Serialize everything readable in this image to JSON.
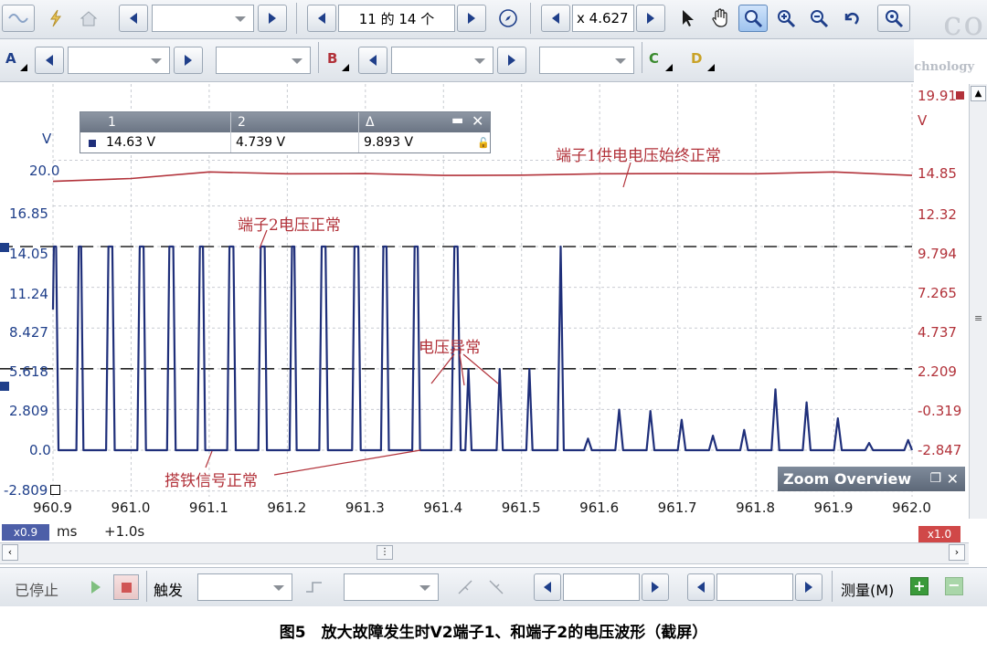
{
  "toolbar": {
    "buffer_nav": "11 的 14 个",
    "zoom_value": "x 4.627"
  },
  "channels": {
    "a": "A",
    "b": "B",
    "c": "C",
    "d": "D"
  },
  "logo": {
    "text": "co",
    "sub": "Technology"
  },
  "ruler_table": {
    "headers": [
      "1",
      "2",
      "Δ"
    ],
    "values": [
      "14.63 V",
      "4.739 V",
      "9.893 V"
    ]
  },
  "axes": {
    "left_unit": "V",
    "right_unit": "V",
    "left_ticks": [
      "20.0",
      "16.85",
      "14.05",
      "11.24",
      "8.427",
      "5.618",
      "2.809",
      "0.0",
      "-2.809"
    ],
    "right_ticks": [
      "19.91",
      "14.85",
      "12.32",
      "9.794",
      "7.265",
      "4.737",
      "2.209",
      "-0.319",
      "-2.847"
    ],
    "x_ticks": [
      "960.9",
      "961.0",
      "961.1",
      "961.2",
      "961.3",
      "961.4",
      "961.5",
      "961.6",
      "961.7",
      "961.8",
      "961.9",
      "962.0"
    ],
    "x_unit": "ms",
    "x_offset": "+1.0s",
    "left_zoom": "x0.9",
    "right_zoom": "x1.0"
  },
  "annotations": {
    "red_line": "端子1供电电压始终正常",
    "blue_high": "端子2电压正常",
    "abnormal": "电压异常",
    "ground": "搭铁信号正常"
  },
  "zoom_overview": {
    "title": "Zoom Overview"
  },
  "bottom": {
    "status": "已停止",
    "trigger": "触发",
    "measure": "测量(M)"
  },
  "caption": "图5　放大故障发生时V2端子1、和端子2的电压波形（截屏）",
  "colors": {
    "channel_a": "#1f2f7a",
    "channel_b": "#b2323a",
    "grid": "#c9ccd2"
  },
  "chart_data": {
    "type": "line",
    "x_range": [
      960.9,
      962.0
    ],
    "x_unit": "ms",
    "series": [
      {
        "axis": "left",
        "y_range": [
          -2.809,
          21.5
        ],
        "points": [
          [
            960.9,
            9.7
          ],
          [
            960.901,
            14.05
          ],
          [
            960.904,
            14.05
          ],
          [
            960.907,
            0.0
          ],
          [
            960.93,
            0.0
          ],
          [
            960.933,
            14.05
          ],
          [
            960.936,
            14.05
          ],
          [
            960.939,
            0.0
          ],
          [
            960.968,
            0.0
          ],
          [
            960.971,
            14.05
          ],
          [
            960.976,
            14.05
          ],
          [
            960.979,
            0.0
          ],
          [
            961.008,
            0.0
          ],
          [
            961.011,
            14.05
          ],
          [
            961.016,
            14.05
          ],
          [
            961.019,
            0.0
          ],
          [
            961.046,
            0.0
          ],
          [
            961.049,
            14.05
          ],
          [
            961.054,
            14.05
          ],
          [
            961.057,
            0.0
          ],
          [
            961.085,
            0.0
          ],
          [
            961.088,
            14.05
          ],
          [
            961.092,
            14.05
          ],
          [
            961.095,
            0.0
          ],
          [
            961.123,
            0.0
          ],
          [
            961.126,
            14.05
          ],
          [
            961.131,
            14.05
          ],
          [
            961.134,
            0.0
          ],
          [
            961.163,
            0.0
          ],
          [
            961.166,
            14.05
          ],
          [
            961.171,
            14.05
          ],
          [
            961.174,
            0.0
          ],
          [
            961.203,
            0.0
          ],
          [
            961.206,
            14.05
          ],
          [
            961.209,
            14.05
          ],
          [
            961.212,
            0.0
          ],
          [
            961.241,
            0.0
          ],
          [
            961.244,
            14.05
          ],
          [
            961.249,
            14.05
          ],
          [
            961.252,
            0.0
          ],
          [
            961.283,
            0.0
          ],
          [
            961.286,
            14.05
          ],
          [
            961.291,
            14.05
          ],
          [
            961.294,
            0.0
          ],
          [
            961.32,
            0.0
          ],
          [
            961.323,
            14.05
          ],
          [
            961.327,
            14.05
          ],
          [
            961.33,
            0.0
          ],
          [
            961.36,
            0.0
          ],
          [
            961.363,
            14.05
          ],
          [
            961.367,
            14.05
          ],
          [
            961.37,
            0.0
          ],
          [
            961.41,
            0.0
          ],
          [
            961.414,
            14.05
          ],
          [
            961.418,
            14.05
          ],
          [
            961.422,
            0.0
          ],
          [
            961.428,
            0.0
          ],
          [
            961.432,
            5.6
          ],
          [
            961.436,
            0.0
          ],
          [
            961.468,
            0.0
          ],
          [
            961.472,
            5.6
          ],
          [
            961.476,
            0.0
          ],
          [
            961.506,
            0.0
          ],
          [
            961.51,
            5.6
          ],
          [
            961.514,
            0.0
          ],
          [
            961.546,
            0.0
          ],
          [
            961.55,
            14.05
          ],
          [
            961.554,
            0.0
          ],
          [
            961.58,
            0.0
          ],
          [
            961.585,
            0.8
          ],
          [
            961.59,
            0.0
          ],
          [
            961.62,
            0.0
          ],
          [
            961.625,
            2.8
          ],
          [
            961.63,
            0.0
          ],
          [
            961.66,
            0.0
          ],
          [
            961.665,
            2.7
          ],
          [
            961.67,
            0.0
          ],
          [
            961.7,
            0.0
          ],
          [
            961.705,
            2.1
          ],
          [
            961.71,
            0.0
          ],
          [
            961.74,
            0.0
          ],
          [
            961.745,
            1.0
          ],
          [
            961.75,
            0.0
          ],
          [
            961.78,
            0.0
          ],
          [
            961.785,
            1.4
          ],
          [
            961.79,
            0.0
          ],
          [
            961.82,
            0.0
          ],
          [
            961.825,
            4.2
          ],
          [
            961.83,
            0.0
          ],
          [
            961.86,
            0.0
          ],
          [
            961.865,
            3.3
          ],
          [
            961.87,
            0.0
          ],
          [
            961.9,
            0.0
          ],
          [
            961.905,
            2.2
          ],
          [
            961.91,
            0.0
          ],
          [
            961.94,
            0.0
          ],
          [
            961.945,
            0.5
          ],
          [
            961.95,
            0.0
          ],
          [
            961.99,
            0.0
          ],
          [
            961.995,
            0.7
          ],
          [
            962.0,
            0.0
          ]
        ]
      },
      {
        "axis": "right",
        "y_range": [
          -2.847,
          21.5
        ],
        "points": [
          [
            960.9,
            14.3
          ],
          [
            961.0,
            14.6
          ],
          [
            961.1,
            14.9
          ],
          [
            961.2,
            14.9
          ],
          [
            961.3,
            14.8
          ],
          [
            961.4,
            14.8
          ],
          [
            961.5,
            14.7
          ],
          [
            961.6,
            14.9
          ],
          [
            961.7,
            14.8
          ],
          [
            961.8,
            14.9
          ],
          [
            961.9,
            14.9
          ],
          [
            962.0,
            14.8
          ]
        ]
      }
    ],
    "rulers_left": [
      14.05,
      5.618
    ]
  }
}
